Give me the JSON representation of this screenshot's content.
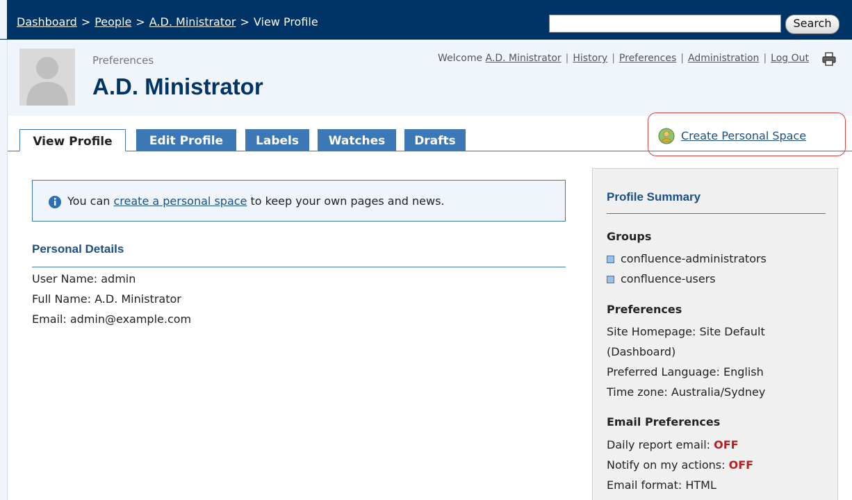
{
  "breadcrumb": {
    "items": [
      "Dashboard",
      "People",
      "A.D. Ministrator"
    ],
    "current": "View Profile",
    "separator": ">"
  },
  "search": {
    "value": "",
    "button_label": "Search"
  },
  "header": {
    "small_label": "Preferences",
    "title": "A.D. Ministrator"
  },
  "user_nav": {
    "welcome_prefix": "Welcome",
    "user_name": "A.D. Ministrator",
    "links": [
      "History",
      "Preferences",
      "Administration",
      "Log Out"
    ],
    "separator": "|",
    "print_icon": "print-icon"
  },
  "tabs": [
    {
      "label": "View Profile",
      "active": true
    },
    {
      "label": "Edit Profile",
      "active": false
    },
    {
      "label": "Labels",
      "active": false
    },
    {
      "label": "Watches",
      "active": false
    },
    {
      "label": "Drafts",
      "active": false
    }
  ],
  "create_space": {
    "label": "Create Personal Space",
    "icon": "create-space-icon"
  },
  "info": {
    "prefix": "You can",
    "link_text": "create a personal space",
    "suffix": "to keep your own pages and news.",
    "icon": "info-icon"
  },
  "personal_details": {
    "heading": "Personal Details",
    "lines": [
      "User Name: admin",
      "Full Name: A.D. Ministrator",
      "Email: admin@example.com"
    ]
  },
  "summary": {
    "title": "Profile Summary",
    "groups_heading": "Groups",
    "groups": [
      "confluence-administrators",
      "confluence-users"
    ],
    "preferences_heading": "Preferences",
    "preferences_lines": [
      "Site Homepage: Site Default",
      "(Dashboard)",
      "Preferred Language: English",
      "Time zone: Australia/Sydney"
    ],
    "email_heading": "Email Preferences",
    "daily_report_label": "Daily report email:",
    "daily_report_value": "OFF",
    "notify_label": "Notify on my actions:",
    "notify_value": "OFF",
    "format_line": "Email format: HTML"
  },
  "colors": {
    "topbar": "#003366",
    "tab_blue": "#3c78b5",
    "link": "#1a4f85",
    "highlight_red": "#d64541",
    "off_red": "#b22222"
  }
}
